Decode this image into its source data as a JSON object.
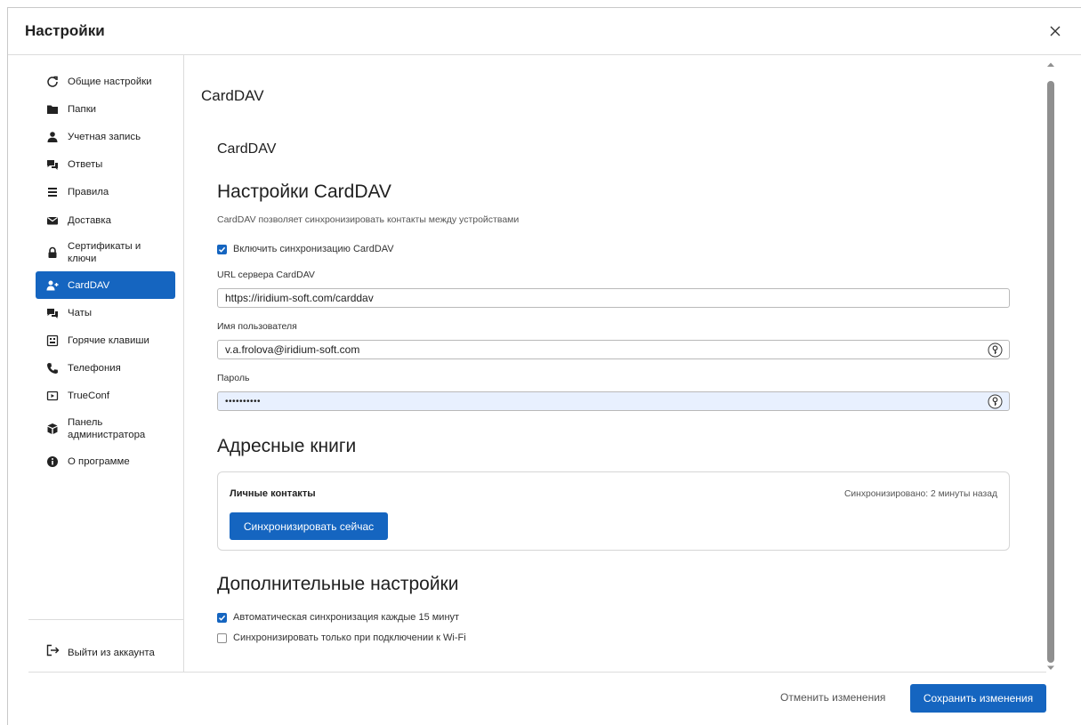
{
  "window": {
    "title": "Настройки"
  },
  "sidebar": {
    "items": [
      {
        "label": "Общие настройки",
        "icon": "refresh-icon"
      },
      {
        "label": "Папки",
        "icon": "folder-icon"
      },
      {
        "label": "Учетная запись",
        "icon": "user-icon"
      },
      {
        "label": "Ответы",
        "icon": "chat-icon"
      },
      {
        "label": "Правила",
        "icon": "list-icon"
      },
      {
        "label": "Доставка",
        "icon": "envelope-icon"
      },
      {
        "label": "Сертификаты и ключи",
        "icon": "lock-icon"
      },
      {
        "label": "CardDAV",
        "icon": "user-plus-icon",
        "active": true
      },
      {
        "label": "Чаты",
        "icon": "chat-icon"
      },
      {
        "label": "Горячие клавиши",
        "icon": "keyboard-icon"
      },
      {
        "label": "Телефония",
        "icon": "phone-icon"
      },
      {
        "label": "TrueConf",
        "icon": "video-icon"
      },
      {
        "label": "Панель администратора",
        "icon": "admin-icon"
      },
      {
        "label": "О программе",
        "icon": "info-icon"
      }
    ],
    "logout_label": "Выйти из аккаунта"
  },
  "content": {
    "page_title": "CardDAV",
    "section_subtitle": "CardDAV",
    "settings_heading": "Настройки CardDAV",
    "description": "CardDAV позволяет синхронизировать контакты между устройствами",
    "enable_sync": {
      "label": "Включить синхронизацию CardDAV",
      "checked": true
    },
    "server_url": {
      "label": "URL сервера CardDAV",
      "value": "https://iridium-soft.com/carddav"
    },
    "username": {
      "label": "Имя пользователя",
      "value": "v.a.frolova@iridium-soft.com"
    },
    "password": {
      "label": "Пароль",
      "value": "••••••••••"
    },
    "address_books_heading": "Адресные книги",
    "address_book": {
      "name": "Личные контакты",
      "status": "Синхронизировано: 2 минуты назад",
      "sync_button": "Синхронизировать сейчас"
    },
    "advanced_heading": "Дополнительные настройки",
    "auto_sync": {
      "label": "Автоматическая синхронизация каждые 15 минут",
      "checked": true
    },
    "wifi_only": {
      "label": "Синхронизировать только при подключении к Wi-Fi",
      "checked": false
    }
  },
  "footer": {
    "cancel_label": "Отменить изменения",
    "save_label": "Сохранить изменения"
  },
  "colors": {
    "accent": "#1565c0",
    "autofill": "#e8f0fe"
  }
}
